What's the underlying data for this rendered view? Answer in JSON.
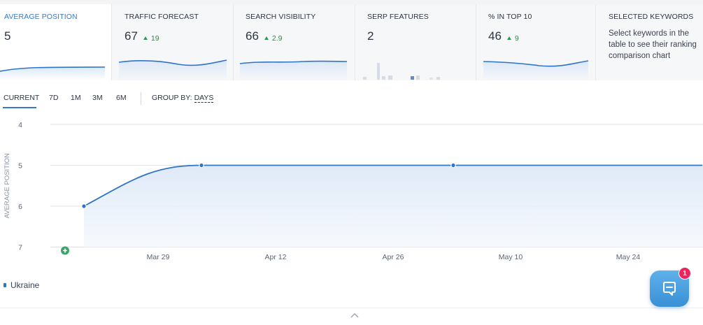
{
  "metrics": [
    {
      "title": "AVERAGE POSITION",
      "value": "5",
      "delta": ""
    },
    {
      "title": "TRAFFIC FORECAST",
      "value": "67",
      "delta": "19"
    },
    {
      "title": "SEARCH VISIBILITY",
      "value": "66",
      "delta": "2.9"
    },
    {
      "title": "SERP FEATURES",
      "value": "2",
      "delta": ""
    },
    {
      "title": "% IN TOP 10",
      "value": "46",
      "delta": "9"
    },
    {
      "title": "SELECTED KEYWORDS",
      "description": "Select keywords in the table to see their ranking comparison chart"
    }
  ],
  "tabs": [
    "CURRENT",
    "7D",
    "1M",
    "3M",
    "6M"
  ],
  "active_tab": "CURRENT",
  "group_by": {
    "label": "GROUP BY:",
    "value": "DAYS"
  },
  "chart_data": {
    "type": "area",
    "ylabel": "AVERAGE POSITION",
    "y_ticks": [
      "4",
      "5",
      "6",
      "7"
    ],
    "ylim": [
      4,
      7
    ],
    "y_inverted": true,
    "x_ticks": [
      "Mar 29",
      "Apr 12",
      "Apr 26",
      "May 10",
      "May 24"
    ],
    "series": [
      {
        "name": "Ukraine",
        "x": [
          "Mar 19",
          "Apr 2",
          "May 2",
          "Jun 1"
        ],
        "values": [
          6,
          5,
          5,
          5
        ]
      }
    ],
    "colors": {
      "line": "#2f74c7",
      "fill": "#dce8f7",
      "grid": "#dfe3e8"
    },
    "annotation_icon": "plus-circle-icon"
  },
  "legend": [
    {
      "label": "Ukraine",
      "color": "#2f74c7"
    }
  ],
  "chat": {
    "badge": "1",
    "icon": "chat-bubble-icon"
  },
  "footer": {
    "icon": "chevron-up-icon"
  }
}
